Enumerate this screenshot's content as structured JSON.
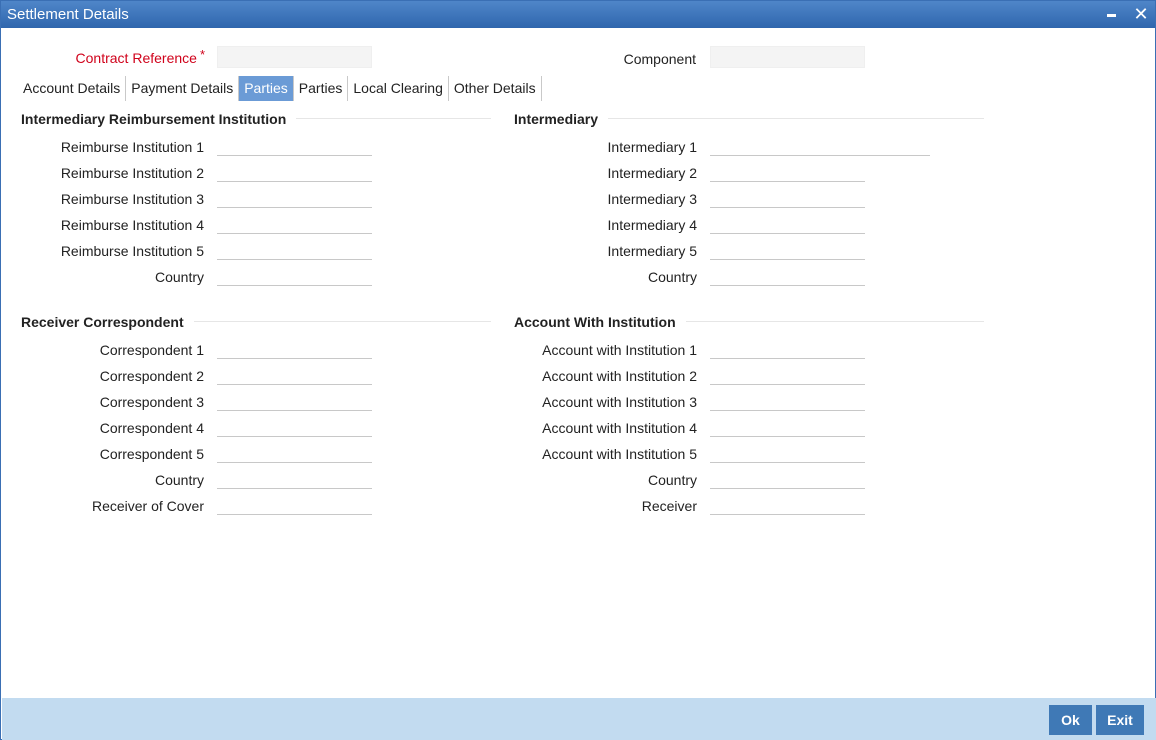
{
  "window": {
    "title": "Settlement Details"
  },
  "header": {
    "contract_reference_label": "Contract Reference",
    "contract_reference_value": "",
    "required_mark": "*",
    "component_label": "Component",
    "component_value": ""
  },
  "tabs": [
    {
      "label": "Account Details",
      "active": false
    },
    {
      "label": "Payment Details",
      "active": false
    },
    {
      "label": "Parties",
      "active": true
    },
    {
      "label": "Parties",
      "active": false
    },
    {
      "label": "Local Clearing",
      "active": false
    },
    {
      "label": "Other Details",
      "active": false
    }
  ],
  "reimbursement": {
    "title": "Intermediary Reimbursement Institution",
    "fields": [
      {
        "label": "Reimburse Institution 1",
        "value": ""
      },
      {
        "label": "Reimburse Institution 2",
        "value": ""
      },
      {
        "label": "Reimburse Institution 3",
        "value": ""
      },
      {
        "label": "Reimburse Institution 4",
        "value": ""
      },
      {
        "label": "Reimburse Institution 5",
        "value": ""
      },
      {
        "label": "Country",
        "value": ""
      }
    ]
  },
  "intermediary": {
    "title": "Intermediary",
    "fields": [
      {
        "label": "Intermediary 1",
        "value": ""
      },
      {
        "label": "Intermediary 2",
        "value": ""
      },
      {
        "label": "Intermediary 3",
        "value": ""
      },
      {
        "label": "Intermediary 4",
        "value": ""
      },
      {
        "label": "Intermediary 5",
        "value": ""
      },
      {
        "label": "Country",
        "value": ""
      }
    ]
  },
  "receiver_correspondent": {
    "title": "Receiver Correspondent",
    "fields": [
      {
        "label": "Correspondent 1",
        "value": ""
      },
      {
        "label": "Correspondent 2",
        "value": ""
      },
      {
        "label": "Correspondent 3",
        "value": ""
      },
      {
        "label": "Correspondent 4",
        "value": ""
      },
      {
        "label": "Correspondent 5",
        "value": ""
      },
      {
        "label": "Country",
        "value": ""
      },
      {
        "label": "Receiver of Cover",
        "value": ""
      }
    ]
  },
  "account_with_institution": {
    "title": "Account With Institution",
    "fields": [
      {
        "label": "Account with Institution 1",
        "value": ""
      },
      {
        "label": "Account with Institution 2",
        "value": ""
      },
      {
        "label": "Account with Institution 3",
        "value": ""
      },
      {
        "label": "Account with Institution 4",
        "value": ""
      },
      {
        "label": "Account with Institution 5",
        "value": ""
      },
      {
        "label": "Country",
        "value": ""
      },
      {
        "label": "Receiver",
        "value": ""
      }
    ]
  },
  "footer": {
    "ok_label": "Ok",
    "exit_label": "Exit"
  },
  "icons": {
    "minimize": "minimize-icon",
    "close": "close-icon"
  },
  "colors": {
    "titlebar": "#2f66ad",
    "active_tab": "#6b9bd6",
    "footer": "#c2dbf0",
    "button": "#3f79b6",
    "required": "#d0021b"
  }
}
